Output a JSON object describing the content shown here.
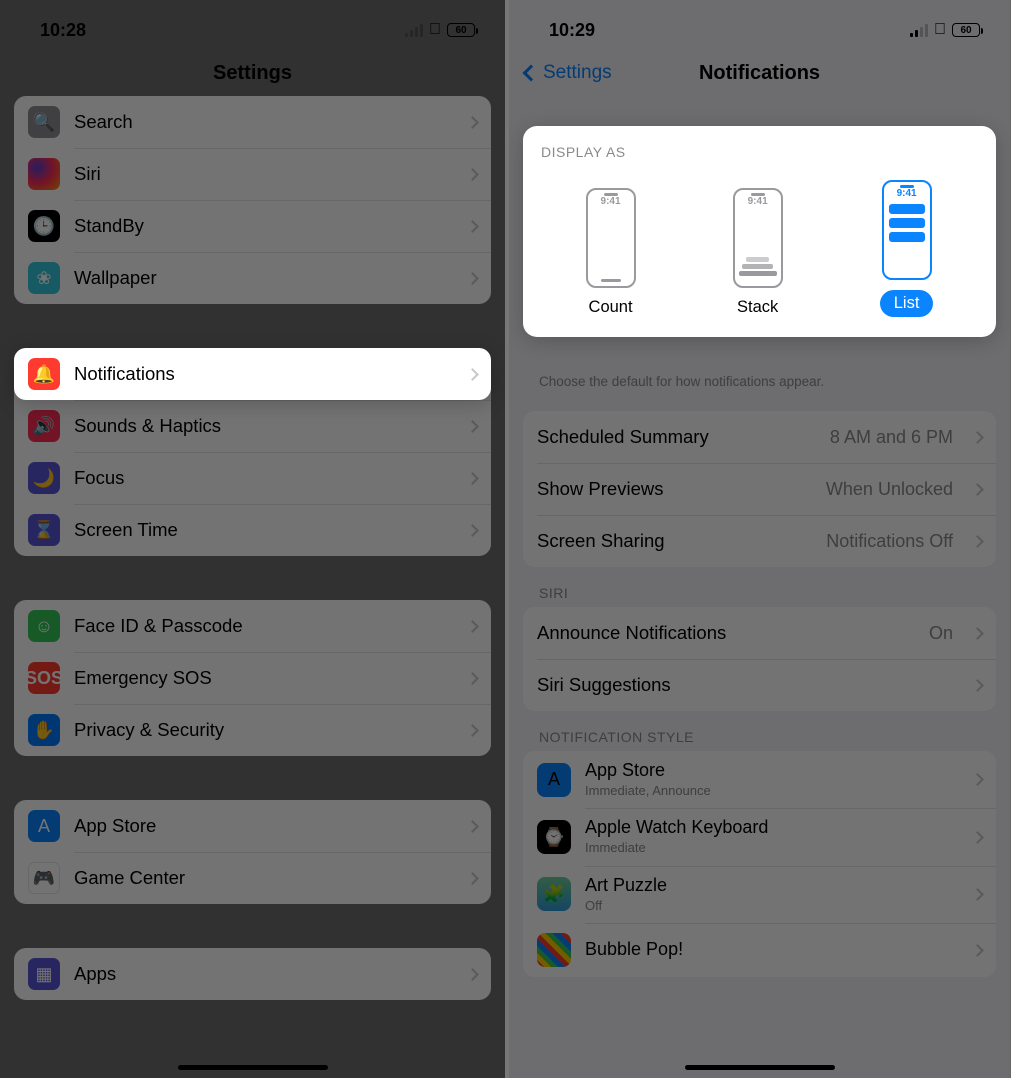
{
  "left": {
    "time": "10:28",
    "battery": "60",
    "title": "Settings",
    "group1": [
      {
        "label": "Search",
        "icon": "ic-search",
        "glyph": "🔍"
      },
      {
        "label": "Siri",
        "icon": "ic-siri",
        "glyph": ""
      },
      {
        "label": "StandBy",
        "icon": "ic-standby",
        "glyph": "🕒"
      },
      {
        "label": "Wallpaper",
        "icon": "ic-wallpaper",
        "glyph": "❀"
      }
    ],
    "highlight": {
      "label": "Notifications",
      "icon": "ic-notif",
      "glyph": "🔔"
    },
    "group2b": [
      {
        "label": "Sounds & Haptics",
        "icon": "ic-sound",
        "glyph": "🔊"
      },
      {
        "label": "Focus",
        "icon": "ic-focus",
        "glyph": "🌙"
      },
      {
        "label": "Screen Time",
        "icon": "ic-screen",
        "glyph": "⌛"
      }
    ],
    "group3": [
      {
        "label": "Face ID & Passcode",
        "icon": "ic-face",
        "glyph": "☺"
      },
      {
        "label": "Emergency SOS",
        "icon": "ic-sos",
        "glyph": "SOS"
      },
      {
        "label": "Privacy & Security",
        "icon": "ic-priv",
        "glyph": "✋"
      }
    ],
    "group4": [
      {
        "label": "App Store",
        "icon": "ic-appstore",
        "glyph": "A"
      },
      {
        "label": "Game Center",
        "icon": "ic-game",
        "glyph": "🎮"
      }
    ],
    "group5": [
      {
        "label": "Apps",
        "icon": "ic-apps",
        "glyph": "▦"
      }
    ]
  },
  "right": {
    "time": "10:29",
    "battery": "60",
    "back": "Settings",
    "title": "Notifications",
    "display_as": {
      "header": "DISPLAY AS",
      "time": "9:41",
      "options": [
        "Count",
        "Stack",
        "List"
      ],
      "selected": 2,
      "footer": "Choose the default for how notifications appear."
    },
    "settings": [
      {
        "label": "Scheduled Summary",
        "value": "8 AM and 6 PM"
      },
      {
        "label": "Show Previews",
        "value": "When Unlocked"
      },
      {
        "label": "Screen Sharing",
        "value": "Notifications Off"
      }
    ],
    "siri_header": "SIRI",
    "siri": [
      {
        "label": "Announce Notifications",
        "value": "On"
      },
      {
        "label": "Siri Suggestions",
        "value": ""
      }
    ],
    "style_header": "NOTIFICATION STYLE",
    "apps": [
      {
        "label": "App Store",
        "sub": "Immediate, Announce",
        "icon": "ic-appstore",
        "glyph": "A"
      },
      {
        "label": "Apple Watch Keyboard",
        "sub": "Immediate",
        "icon": "ic-watch",
        "glyph": "⌚"
      },
      {
        "label": "Art Puzzle",
        "sub": "Off",
        "icon": "ic-art",
        "glyph": "🧩"
      },
      {
        "label": "Bubble Pop!",
        "sub": "",
        "icon": "ic-bub",
        "glyph": ""
      }
    ]
  }
}
